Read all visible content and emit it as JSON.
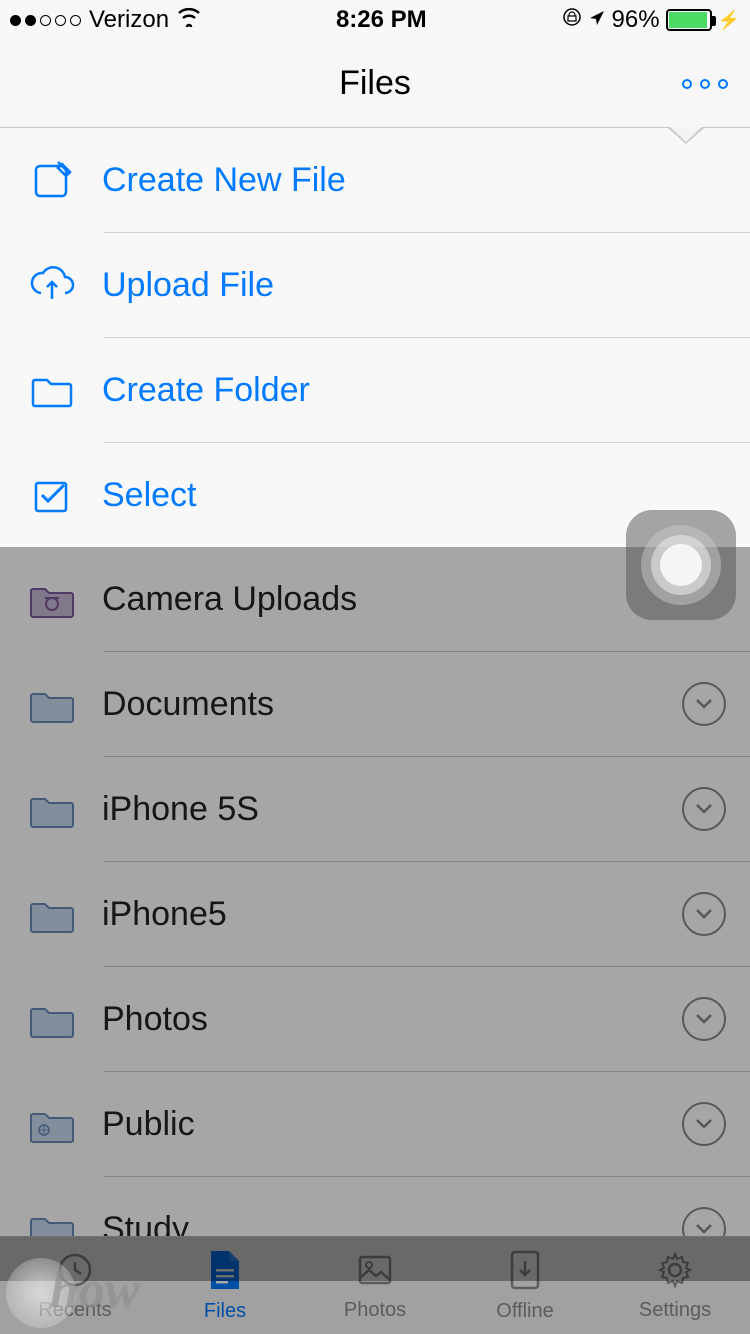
{
  "status": {
    "carrier": "Verizon",
    "time": "8:26 PM",
    "battery_pct": "96%",
    "battery_level": 96
  },
  "nav": {
    "title": "Files"
  },
  "menu": [
    {
      "icon": "create-file-icon",
      "label": "Create New File"
    },
    {
      "icon": "upload-icon",
      "label": "Upload File"
    },
    {
      "icon": "create-folder-icon",
      "label": "Create Folder"
    },
    {
      "icon": "select-icon",
      "label": "Select"
    }
  ],
  "folders": [
    {
      "icon": "camera-folder-icon",
      "label": "Camera Uploads"
    },
    {
      "icon": "folder-icon",
      "label": "Documents"
    },
    {
      "icon": "folder-icon",
      "label": "iPhone 5S"
    },
    {
      "icon": "folder-icon",
      "label": "iPhone5"
    },
    {
      "icon": "folder-icon",
      "label": "Photos"
    },
    {
      "icon": "public-folder-icon",
      "label": "Public"
    },
    {
      "icon": "folder-icon",
      "label": "Study"
    }
  ],
  "tabs": [
    {
      "label": "Recents",
      "active": false
    },
    {
      "label": "Files",
      "active": true
    },
    {
      "label": "Photos",
      "active": false
    },
    {
      "label": "Offline",
      "active": false
    },
    {
      "label": "Settings",
      "active": false
    }
  ],
  "watermark": "how"
}
